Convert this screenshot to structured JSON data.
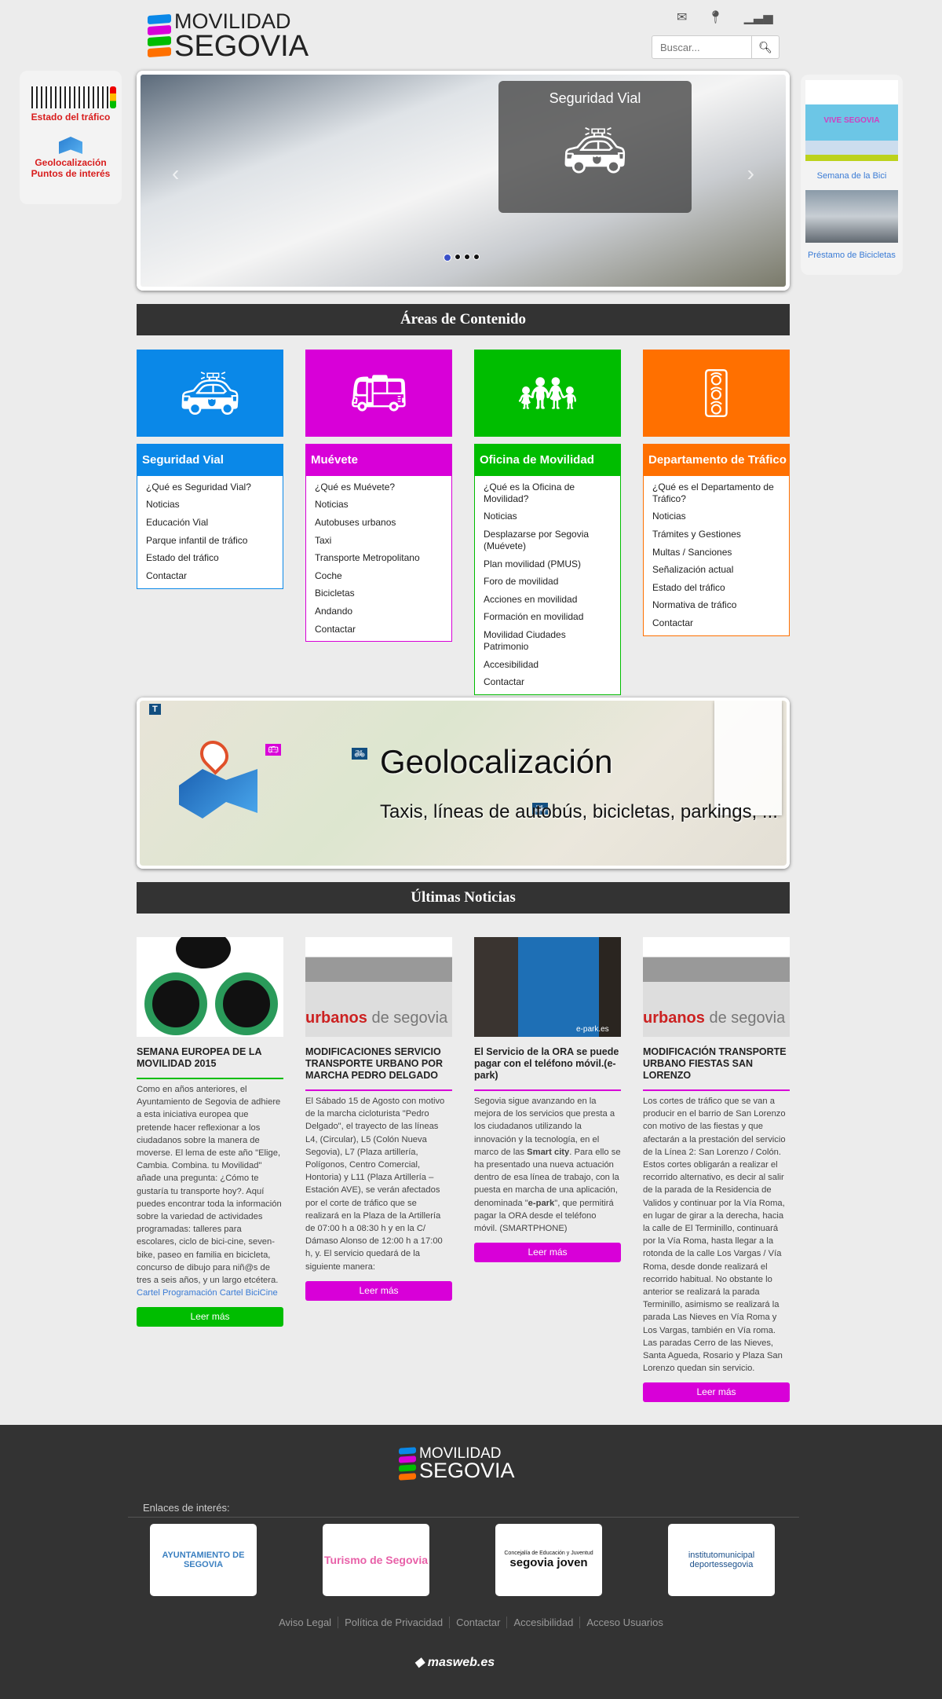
{
  "header": {
    "logo_line1": "MOVILIDAD",
    "logo_line2": "SEGOVIA",
    "search_placeholder": "Buscar...",
    "icons": [
      "envelope-icon",
      "map-marker-icon",
      "signal-icon"
    ]
  },
  "left_sidebar": {
    "traffic": "Estado del tráfico",
    "geo_line1": "Geolocalización",
    "geo_line2": "Puntos de interés"
  },
  "carousel": {
    "caption": "Seguridad Vial",
    "slides": 4,
    "active": 1
  },
  "right_sidebar": {
    "item1": "Semana de la Bici",
    "item2": "Préstamo de Bicicletas",
    "banner_text": "VIVE SEGOVIA"
  },
  "areas": {
    "title": "Áreas de Contenido",
    "cards": [
      {
        "title": "Seguridad Vial",
        "color": "#0a88e8",
        "items": [
          "¿Qué es Seguridad Vial?",
          "Noticias",
          "Educación Vial",
          "Parque infantil de tráfico",
          "Estado del tráfico",
          "Contactar"
        ]
      },
      {
        "title": "Muévete",
        "color": "#d800d8",
        "items": [
          "¿Qué es Muévete?",
          "Noticias",
          "Autobuses urbanos",
          "Taxi",
          "Transporte Metropolitano",
          "Coche",
          "Bicicletas",
          "Andando",
          "Contactar"
        ]
      },
      {
        "title": "Oficina de Movilidad",
        "color": "#00bd00",
        "items": [
          "¿Qué es la Oficina de Movilidad?",
          "Noticias",
          "Desplazarse por Segovia (Muévete)",
          "Plan movilidad (PMUS)",
          "Foro de movilidad",
          "Acciones en movilidad",
          "Formación en movilidad",
          "Movilidad Ciudades Patrimonio",
          "Accesibilidad",
          "Contactar"
        ]
      },
      {
        "title": "Departamento de Tráfico",
        "color": "#ff7000",
        "items": [
          "¿Qué es el Departamento de Tráfico?",
          "Noticias",
          "Trámites y Gestiones",
          "Multas / Sanciones",
          "Señalización actual",
          "Estado del tráfico",
          "Normativa de tráfico",
          "Contactar"
        ]
      }
    ]
  },
  "map": {
    "title": "Geolocalización",
    "subtitle": "Taxis, líneas de autobús, bicicletas, parkings, ..."
  },
  "news": {
    "title": "Últimas Noticias",
    "read_more": "Leer más",
    "items": [
      {
        "title": "SEMANA EUROPEA DE LA MOVILIDAD 2015",
        "color": "#00bd00",
        "body": "Como en años anteriores, el Ayuntamiento de Segovia de adhiere a esta iniciativa europea que pretende hacer reflexionar a los ciudadanos sobre la manera de moverse. El lema de este año \"Elige, Cambia. Combina. tu Movilidad\" añade una pregunta: ¿Cómo te gustaría tu transporte hoy?. Aquí puedes encontrar toda la información sobre la variedad de actividades programadas: talleres para escolares, ciclo de bici-cine, seven-bike, paseo en familia en bicicleta, concurso de dibujo para niñ@s de tres a seis años, y un largo etcétera.",
        "link": "Cartel Programación Cartel BiciCine"
      },
      {
        "title": "MODIFICACIONES SERVICIO TRANSPORTE URBANO POR MARCHA PEDRO DELGADO",
        "color": "#d800d8",
        "body": "El Sábado 15 de Agosto con motivo de la marcha cicloturista \"Pedro Delgado\", el trayecto de las líneas L4, (Circular), L5 (Colón Nueva Segovia), L7 (Plaza artillería, Polígonos, Centro Comercial, Hontoria) y L11 (Plaza Artillería – Estación AVE), se verán afectados por el corte de tráfico que se realizará en la Plaza de la Artillería de 07:00 h a 08:30 h y en la C/ Dámaso Alonso de 12:00 h a 17:00 h, y. El servicio quedará de la siguiente manera:",
        "link": ""
      },
      {
        "title": "El Servicio de la ORA se puede pagar con el teléfono móvil.(e-park)",
        "color": "#d800d8",
        "body_parts": [
          "Segovia sigue avanzando en la mejora de los servicios que presta a los ciudadanos utilizando la innovación y la tecnología, en el marco de las ",
          "Smart city",
          ". Para ello se ha presentado una nueva actuación dentro de esa línea de trabajo, con la puesta en marcha de una aplicación, denominada \"",
          "e-park",
          "\", que permitirá pagar la ORA desde el teléfono móvil. (SMARTPHONE)"
        ]
      },
      {
        "title": "MODIFICACIÓN TRANSPORTE URBANO FIESTAS SAN LORENZO",
        "color": "#d800d8",
        "body": "Los cortes de tráfico que se van a producir en el barrio de San Lorenzo con motivo de las fiestas y que afectarán a la prestación del servicio de la Línea 2: San Lorenzo / Colón. Estos cortes obligarán a realizar el recorrido alternativo, es decir  al salir de la parada de la Residencia de Validos y continuar por la Vía Roma, en lugar de girar a la derecha, hacia la calle de El Terminillo, continuará por la Vía Roma, hasta llegar a la rotonda de la calle Los Vargas / Vía Roma, desde donde realizará el recorrido habitual. No obstante lo anterior se realizará la parada Terminillo,  asimismo se realizará la parada Las Nieves en Vía Roma y Los Vargas, también en Vía roma. Las paradas  Cerro de las Nieves, Santa Agueda, Rosario y Plaza San Lorenzo quedan sin servicio."
      }
    ],
    "image_text": {
      "urbanos": "urbanos",
      "de_segovia": "de segovia",
      "epark": "e-park.es"
    }
  },
  "footer": {
    "links_title": "Enlaces de interés:",
    "partners": [
      "AYUNTAMIENTO DE SEGOVIA",
      "Turismo de Segovia",
      "segovia joven",
      "institutomunicipal deportessegovia"
    ],
    "partner_sub": "Concejalía de Educación y Juventud",
    "links": [
      "Aviso Legal",
      "Política de Privacidad",
      "Contactar",
      "Accesibilidad",
      "Acceso Usuarios"
    ],
    "credit": "masweb.es"
  }
}
